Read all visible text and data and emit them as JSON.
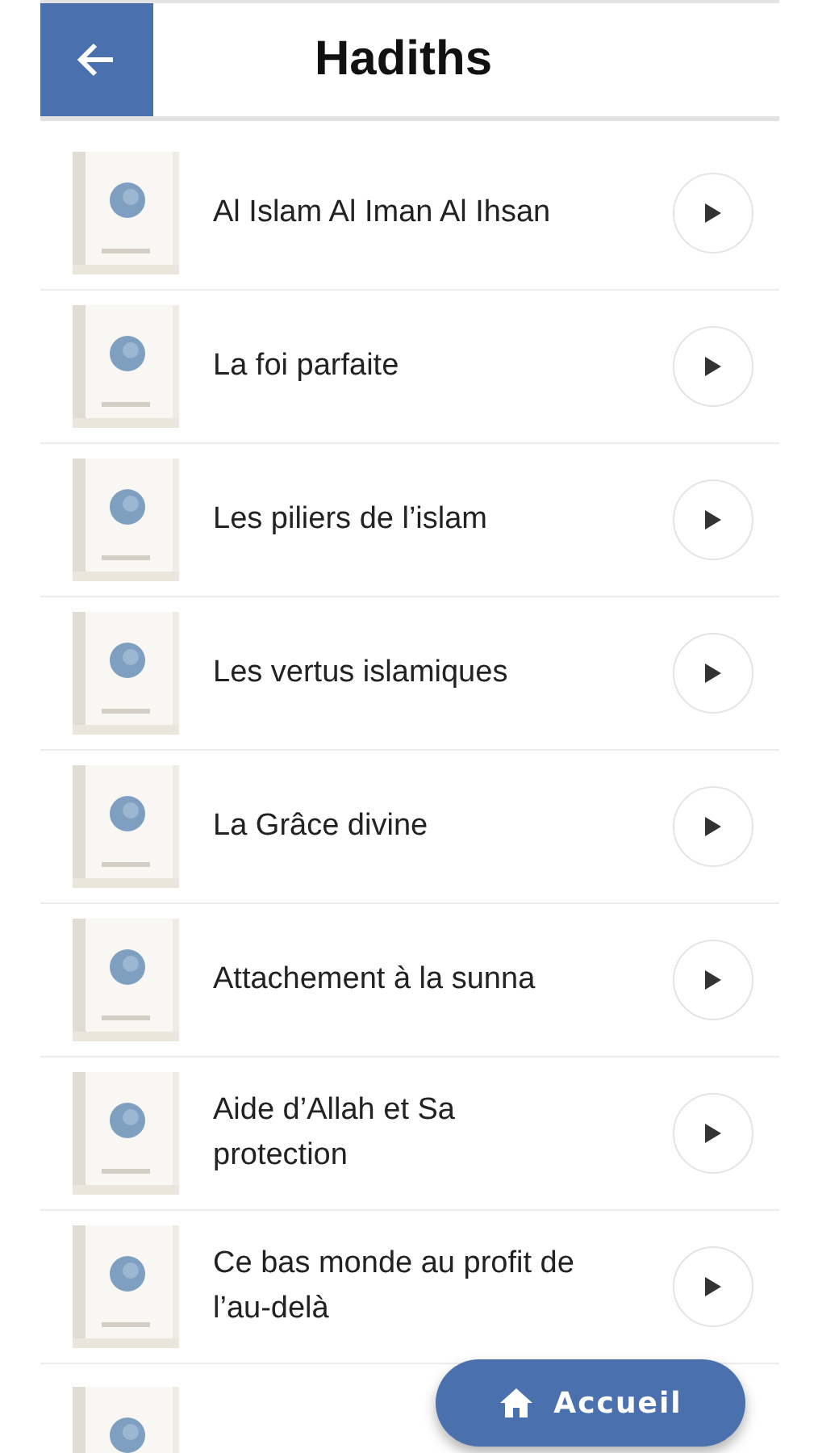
{
  "header": {
    "title": "Hadiths"
  },
  "items": [
    {
      "title": "Al Islam Al Iman Al Ihsan"
    },
    {
      "title": "La foi parfaite"
    },
    {
      "title": "Les piliers de l’islam"
    },
    {
      "title": "Les vertus islamiques"
    },
    {
      "title": "La Grâce divine"
    },
    {
      "title": "Attachement à la sunna"
    },
    {
      "title": "Aide d’Allah et Sa protection"
    },
    {
      "title": "Ce bas monde au profit de l’au-delà"
    }
  ],
  "fab": {
    "label": "Accueil"
  }
}
